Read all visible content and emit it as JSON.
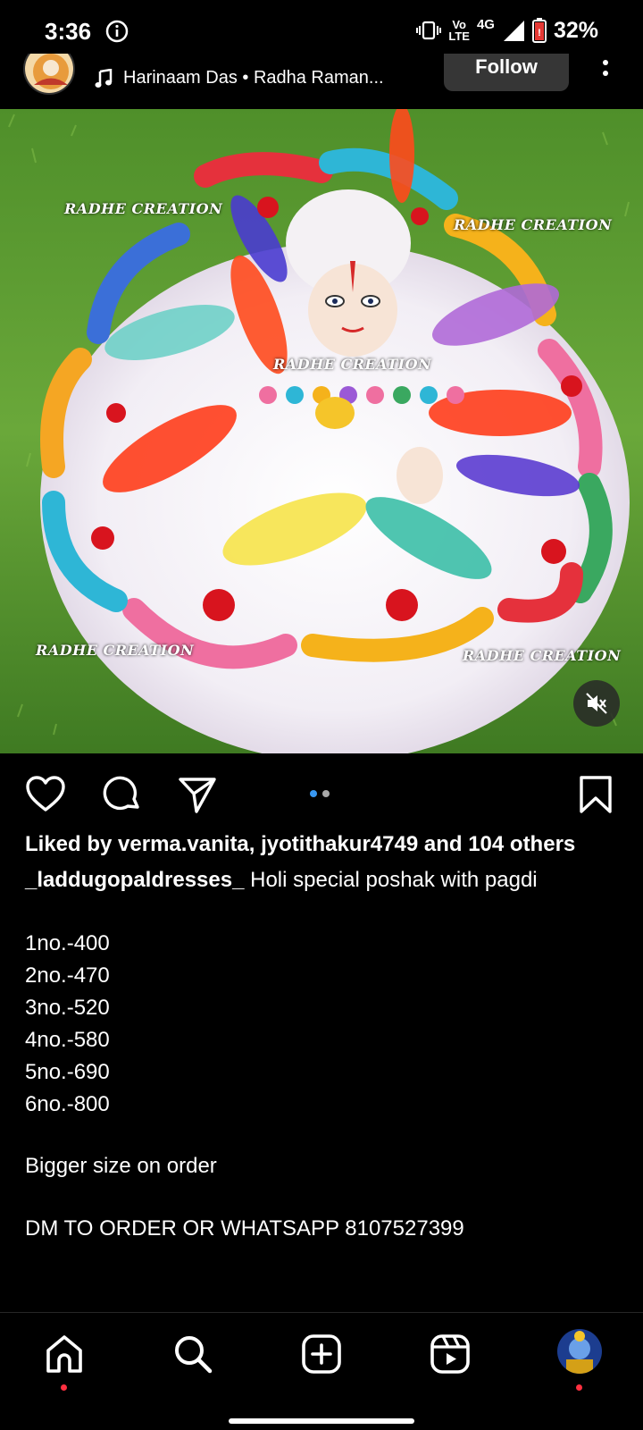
{
  "status_bar": {
    "time": "3:36",
    "network": "4G",
    "volte_line1": "Vo",
    "volte_line2": "LTE",
    "battery": "32%"
  },
  "post_header": {
    "music_text": "Harinaam Das • Radha Raman...",
    "follow_label": "Follow"
  },
  "image": {
    "watermark": "RADHE CREATION"
  },
  "actions": {
    "carousel_total": 2,
    "carousel_active": 1,
    "accent_color": "#3897f0"
  },
  "caption": {
    "likes": "Liked by verma.vanita, jyotithakur4749 and 104 others",
    "username": "_laddugopaldresses_",
    "title": "Holi special poshak with pagdi",
    "prices": [
      "1no.-400",
      "2no.-470",
      "3no.-520",
      "4no.-580",
      "5no.-690",
      "6no.-800"
    ],
    "note": "Bigger size on order",
    "contact": "DM TO ORDER OR WHATSAPP 8107527399"
  },
  "nav": {
    "items": [
      "home-icon",
      "search-icon",
      "create-icon",
      "reels-icon",
      "profile-avatar"
    ],
    "notification_color": "#ff3040"
  }
}
